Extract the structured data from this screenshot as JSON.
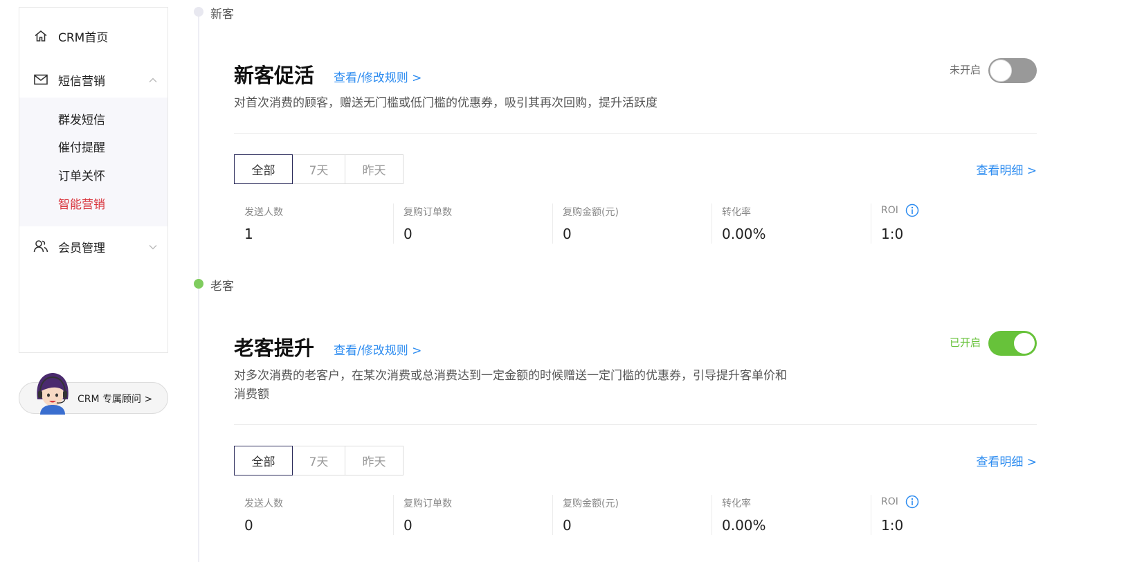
{
  "sidebar": {
    "items": [
      {
        "label": "CRM首页",
        "icon": "home-icon"
      },
      {
        "label": "短信营销",
        "icon": "mail-icon",
        "expanded": true
      },
      {
        "label": "会员管理",
        "icon": "members-icon",
        "expanded": false
      }
    ],
    "submenu": [
      {
        "label": "群发短信"
      },
      {
        "label": "催付提醒"
      },
      {
        "label": "订单关怀"
      },
      {
        "label": "智能营销",
        "active": true
      }
    ]
  },
  "advisor": {
    "label": "CRM 专属顾问 >"
  },
  "timeline": {
    "new_label": "新客",
    "old_label": "老客"
  },
  "cards": [
    {
      "title": "新客促活",
      "rule_link": "查看/修改规则 >",
      "description": "对首次消费的顾客，赠送无门槛或低门槛的优惠券，吸引其再次回购，提升活跃度",
      "status": "未开启",
      "enabled": false,
      "tabs": [
        "全部",
        "7天",
        "昨天"
      ],
      "active_tab": "全部",
      "detail_link": "查看明细 >",
      "stats": [
        {
          "label": "发送人数",
          "value": "1"
        },
        {
          "label": "复购订单数",
          "value": "0"
        },
        {
          "label": "复购金额(元)",
          "value": "0"
        },
        {
          "label": "转化率",
          "value": "0.00%"
        },
        {
          "label": "ROI",
          "value": "1:0"
        }
      ]
    },
    {
      "title": "老客提升",
      "rule_link": "查看/修改规则 >",
      "description": "对多次消费的老客户，在某次消费或总消费达到一定金额的时候赠送一定门槛的优惠券，引导提升客单价和消费额",
      "status": "已开启",
      "enabled": true,
      "tabs": [
        "全部",
        "7天",
        "昨天"
      ],
      "active_tab": "全部",
      "detail_link": "查看明细 >",
      "stats": [
        {
          "label": "发送人数",
          "value": "0"
        },
        {
          "label": "复购订单数",
          "value": "0"
        },
        {
          "label": "复购金额(元)",
          "value": "0"
        },
        {
          "label": "转化率",
          "value": "0.00%"
        },
        {
          "label": "ROI",
          "value": "1:0"
        }
      ]
    }
  ],
  "colors": {
    "accent_link": "#2d8cf0",
    "active_menu": "#d9363e",
    "toggle_on": "#67c23a",
    "toggle_off": "#999999",
    "status_on": "#67c23a",
    "status_off": "#666666"
  }
}
